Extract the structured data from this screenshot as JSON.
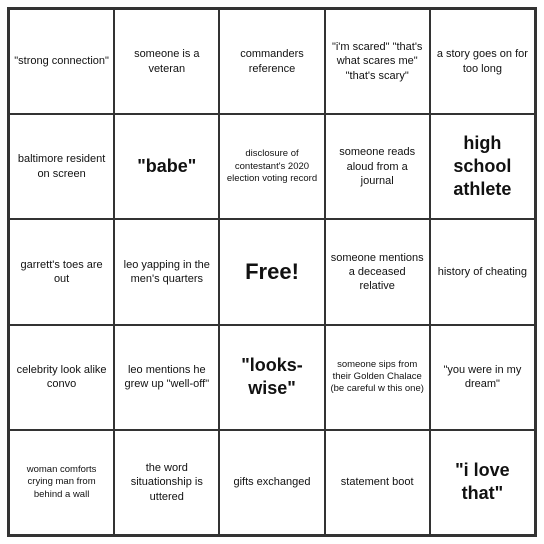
{
  "cells": [
    {
      "id": "r0c0",
      "text": "\"strong connection\"",
      "style": "normal"
    },
    {
      "id": "r0c1",
      "text": "someone is a veteran",
      "style": "normal"
    },
    {
      "id": "r0c2",
      "text": "commanders reference",
      "style": "normal"
    },
    {
      "id": "r0c3",
      "text": "\"i'm scared\" \"that's what scares me\" \"that's scary\"",
      "style": "normal"
    },
    {
      "id": "r0c4",
      "text": "a story goes on for too long",
      "style": "normal"
    },
    {
      "id": "r1c0",
      "text": "baltimore resident on screen",
      "style": "normal"
    },
    {
      "id": "r1c1",
      "text": "\"babe\"",
      "style": "large-text"
    },
    {
      "id": "r1c2",
      "text": "disclosure of contestant's 2020 election voting record",
      "style": "small"
    },
    {
      "id": "r1c3",
      "text": "someone reads aloud from a journal",
      "style": "normal"
    },
    {
      "id": "r1c4",
      "text": "high school athlete",
      "style": "large-text"
    },
    {
      "id": "r2c0",
      "text": "garrett's toes are out",
      "style": "normal"
    },
    {
      "id": "r2c1",
      "text": "leo yapping in the men's quarters",
      "style": "normal"
    },
    {
      "id": "r2c2",
      "text": "Free!",
      "style": "free"
    },
    {
      "id": "r2c3",
      "text": "someone mentions a deceased relative",
      "style": "normal"
    },
    {
      "id": "r2c4",
      "text": "history of cheating",
      "style": "normal"
    },
    {
      "id": "r3c0",
      "text": "celebrity look alike convo",
      "style": "normal"
    },
    {
      "id": "r3c1",
      "text": "leo mentions he grew up \"well-off\"",
      "style": "normal"
    },
    {
      "id": "r3c2",
      "text": "\"looks-wise\"",
      "style": "large-text"
    },
    {
      "id": "r3c3",
      "text": "someone sips from their Golden Chalace (be careful w this one)",
      "style": "small"
    },
    {
      "id": "r3c4",
      "text": "\"you were in my dream\"",
      "style": "normal"
    },
    {
      "id": "r4c0",
      "text": "woman comforts crying man from behind a wall",
      "style": "small"
    },
    {
      "id": "r4c1",
      "text": "the word situationship is uttered",
      "style": "normal"
    },
    {
      "id": "r4c2",
      "text": "gifts exchanged",
      "style": "normal"
    },
    {
      "id": "r4c3",
      "text": "statement boot",
      "style": "normal"
    },
    {
      "id": "r4c4",
      "text": "\"i love that\"",
      "style": "large-text"
    }
  ]
}
